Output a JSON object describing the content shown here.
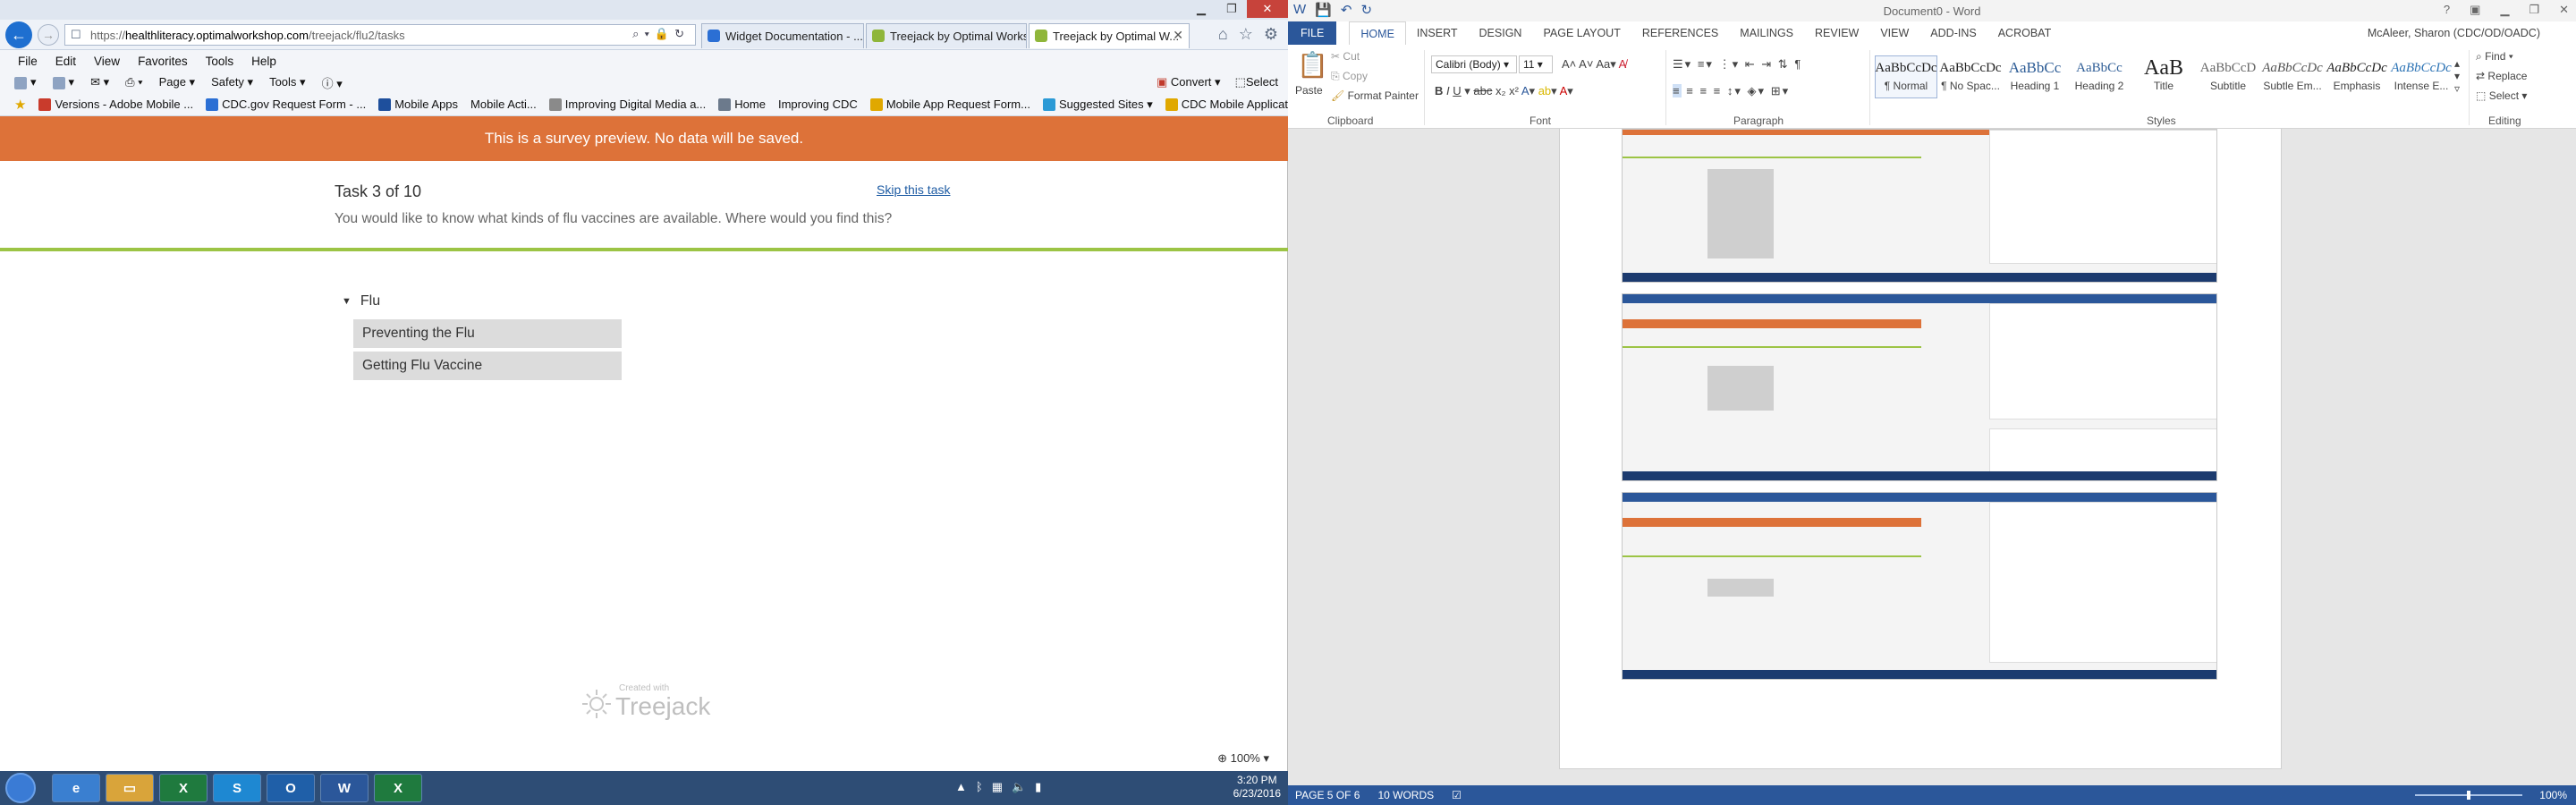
{
  "browser": {
    "url_scheme": "https://",
    "url_host": "healthliteracy.optimalworkshop.com",
    "url_path": "/treejack/flu2/tasks",
    "tabs": [
      {
        "label": "Widget Documentation - ...",
        "active": false
      },
      {
        "label": "Treejack by Optimal Works...",
        "active": false
      },
      {
        "label": "Treejack by Optimal W...",
        "active": true
      }
    ],
    "menu": [
      "File",
      "Edit",
      "View",
      "Favorites",
      "Tools",
      "Help"
    ],
    "command_bar": [
      "Page ▾",
      "Safety ▾",
      "Tools ▾"
    ],
    "convert_label": "Convert",
    "select_label": "Select",
    "favorites": [
      "Versions - Adobe Mobile ...",
      "CDC.gov Request Form - ...",
      "Mobile Apps",
      "Mobile Acti...",
      "Improving Digital Media a...",
      "Home",
      "Improving CDC",
      "Mobile App Request Form...",
      "Suggested Sites ▾",
      "CDC Mobile Applications ..."
    ],
    "zoom": "100%"
  },
  "survey": {
    "banner": "This is a survey preview. No data will be saved.",
    "task_title": "Task 3 of 10",
    "skip_label": "Skip this task",
    "task_description": "You would like to know what kinds of flu vaccines are available. Where would you find this?",
    "tree_root": "Flu",
    "tree_items": [
      "Preventing the Flu",
      "Getting Flu Vaccine"
    ],
    "created_with": "Created with",
    "brand": "Treejack"
  },
  "word": {
    "doc_title": "Document0 - Word",
    "user": "McAleer, Sharon (CDC/OD/OADC)",
    "file_tab": "FILE",
    "tabs": [
      "HOME",
      "INSERT",
      "DESIGN",
      "PAGE LAYOUT",
      "REFERENCES",
      "MAILINGS",
      "REVIEW",
      "VIEW",
      "ADD-INS",
      "ACROBAT"
    ],
    "active_tab": "HOME",
    "clipboard": {
      "paste": "Paste",
      "cut": "Cut",
      "copy": "Copy",
      "format_painter": "Format Painter",
      "group": "Clipboard"
    },
    "font": {
      "name": "Calibri (Body)",
      "size": "11",
      "group": "Font"
    },
    "paragraph_group": "Paragraph",
    "styles_group": "Styles",
    "styles": [
      {
        "sample": "AaBbCcDc",
        "name": "¶ Normal"
      },
      {
        "sample": "AaBbCcDc",
        "name": "¶ No Spac..."
      },
      {
        "sample": "AaBbCc",
        "name": "Heading 1"
      },
      {
        "sample": "AaBbCc",
        "name": "Heading 2"
      },
      {
        "sample": "AaB",
        "name": "Title"
      },
      {
        "sample": "AaBbCcD",
        "name": "Subtitle"
      },
      {
        "sample": "AaBbCcDc",
        "name": "Subtle Em..."
      },
      {
        "sample": "AaBbCcDc",
        "name": "Emphasis"
      },
      {
        "sample": "AaBbCcDc",
        "name": "Intense E..."
      }
    ],
    "editing": {
      "find": "Find ▾",
      "replace": "Replace",
      "select": "Select ▾",
      "group": "Editing"
    },
    "status_page": "PAGE 5 OF 6",
    "status_words": "10 WORDS",
    "zoom": "100%"
  },
  "taskbar": {
    "time": "3:20 PM",
    "date": "6/23/2016"
  },
  "colors": {
    "banner_orange": "#dd7239",
    "rule_green": "#9cc445",
    "word_blue": "#2b579a",
    "link_blue": "#1d5ba3"
  }
}
